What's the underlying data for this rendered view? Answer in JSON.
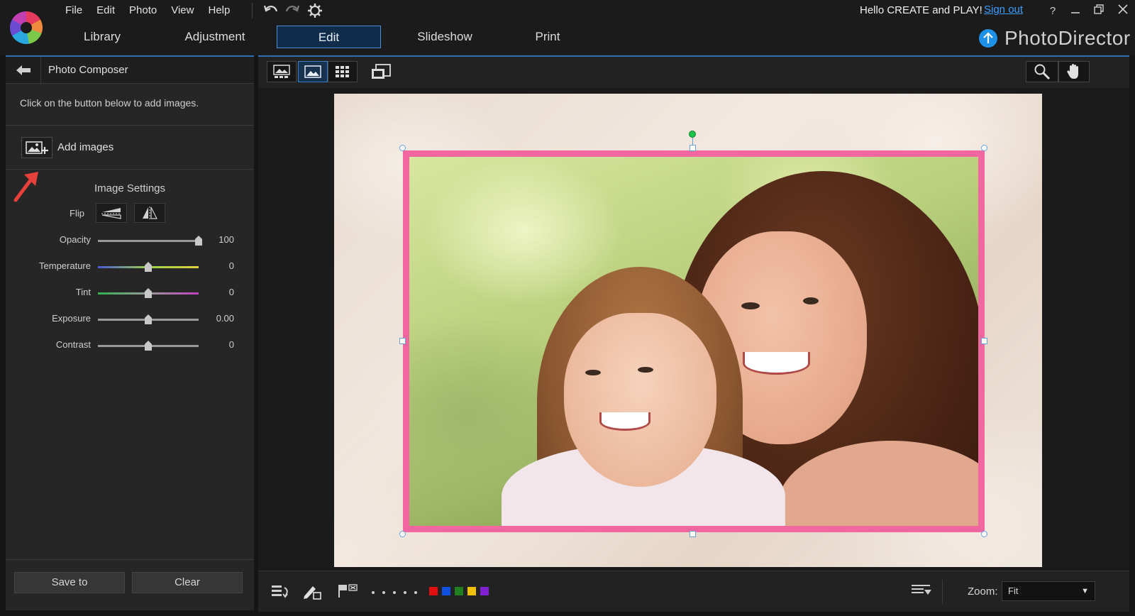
{
  "menu": {
    "items": [
      "File",
      "Edit",
      "Photo",
      "View",
      "Help"
    ]
  },
  "tabs": [
    {
      "label": "Library"
    },
    {
      "label": "Adjustment"
    },
    {
      "label": "Edit"
    },
    {
      "label": "Slideshow"
    },
    {
      "label": "Print"
    }
  ],
  "account": {
    "greeting": "Hello CREATE and PLAY!",
    "sign_out": "Sign out",
    "help": "?"
  },
  "brand": {
    "name": "PhotoDirector"
  },
  "panel": {
    "title": "Photo Composer",
    "hint": "Click on the button below to add images.",
    "add_images": "Add images",
    "settings_title": "Image Settings",
    "flip_label": "Flip",
    "sliders": [
      {
        "label": "Opacity",
        "value": "100",
        "level": 1.0
      },
      {
        "label": "Temperature",
        "value": "0",
        "level": 0.5
      },
      {
        "label": "Tint",
        "value": "0",
        "level": 0.5
      },
      {
        "label": "Exposure",
        "value": "0.00",
        "level": 0.5
      },
      {
        "label": "Contrast",
        "value": "0",
        "level": 0.5
      }
    ],
    "save_to": "Save to",
    "clear": "Clear"
  },
  "view": {
    "zoom_label": "Zoom:",
    "zoom_value": "Fit"
  },
  "colors": {
    "accent": "#2f6fb5",
    "frame": "#f2679f",
    "flag_swatches": [
      "#e01010",
      "#1050e0",
      "#208020",
      "#f0c000",
      "#8020d0"
    ]
  }
}
